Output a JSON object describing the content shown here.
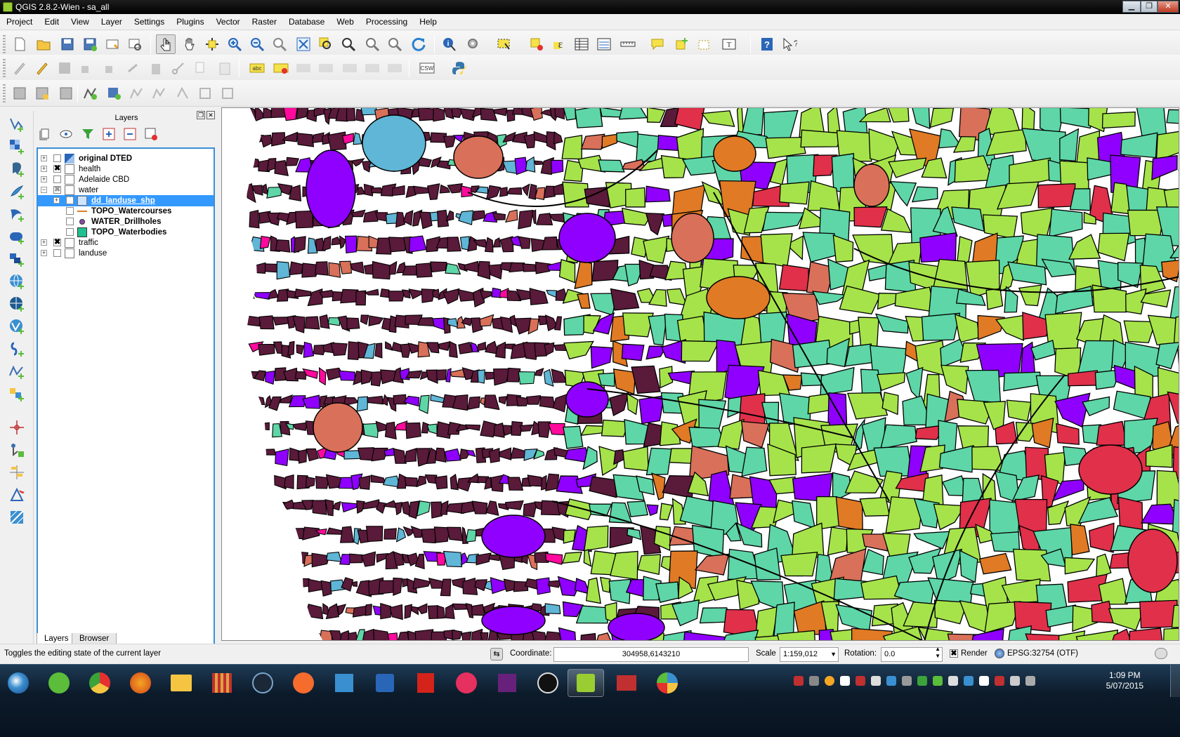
{
  "window": {
    "title": "QGIS 2.8.2-Wien - sa_all",
    "minimize": "▁",
    "restore": "❐",
    "close": "✕"
  },
  "menu": [
    "Project",
    "Edit",
    "View",
    "Layer",
    "Settings",
    "Plugins",
    "Vector",
    "Raster",
    "Database",
    "Web",
    "Processing",
    "Help"
  ],
  "toolbar": {
    "csw_label": "CSW",
    "abc_label": "abc"
  },
  "layers_panel": {
    "title": "Layers",
    "tree": [
      {
        "name": "original DTED",
        "bold": true,
        "checked": false,
        "type": "raster-group"
      },
      {
        "name": "health",
        "bold": false,
        "checked": true,
        "type": "group"
      },
      {
        "name": "Adelaide CBD",
        "bold": false,
        "checked": false,
        "type": "group"
      },
      {
        "name": "water",
        "bold": false,
        "checked": "partial",
        "type": "group",
        "expanded": true
      },
      {
        "name": "dd_landuse_shp",
        "bold": true,
        "checked": true,
        "type": "group",
        "selected": true,
        "indent": 1
      },
      {
        "name": "TOPO_Watercourses",
        "bold": true,
        "checked": false,
        "type": "line",
        "indent": 1
      },
      {
        "name": "WATER_Drillholes",
        "bold": true,
        "checked": false,
        "type": "point",
        "indent": 1
      },
      {
        "name": "TOPO_Waterbodies",
        "bold": true,
        "checked": false,
        "type": "polygon",
        "indent": 1
      },
      {
        "name": "traffic",
        "bold": false,
        "checked": true,
        "type": "group"
      },
      {
        "name": "landuse",
        "bold": false,
        "checked": false,
        "type": "group"
      }
    ],
    "tabs": [
      "Layers",
      "Browser"
    ]
  },
  "statusbar": {
    "message": "Toggles the editing state of the current layer",
    "coordinate_label": "Coordinate:",
    "coordinate_value": "304958,6143210",
    "scale_label": "Scale",
    "scale_value": "1:159,012",
    "rotation_label": "Rotation:",
    "rotation_value": "0.0",
    "render_label": "Render",
    "crs": "EPSG:32754 (OTF)"
  },
  "taskbar": {
    "time": "1:09 PM",
    "date": "5/07/2015"
  },
  "colors": {
    "urban": "#5a1a3a",
    "purple": "#8f00ff",
    "green": "#a6e34a",
    "teal": "#5ed6a8",
    "orange": "#e07a25",
    "salmon": "#d9705a",
    "red": "#e0304a",
    "blue": "#5fb6d6",
    "magenta": "#ff0a9c",
    "selection": "#3399ff"
  }
}
